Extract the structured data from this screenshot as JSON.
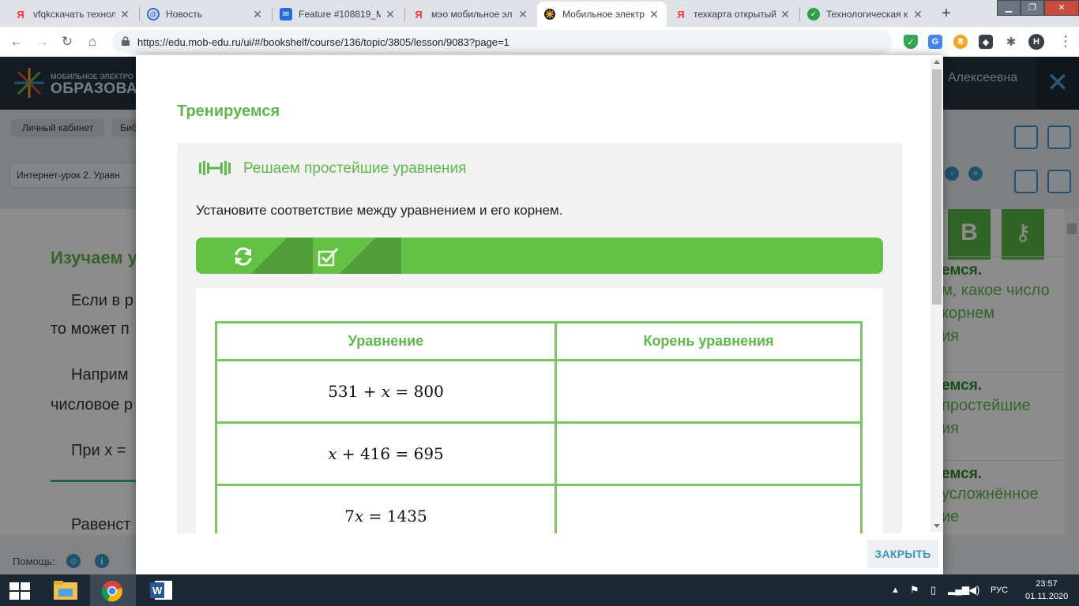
{
  "browser": {
    "tabs": [
      {
        "label": "vfqkскачать технол",
        "favicon": "yandex-icon",
        "favicon_color": "#f33"
      },
      {
        "label": "Новость",
        "favicon": "at-icon",
        "favicon_color": "#2a6ad8"
      },
      {
        "label": "Feature #108819_М",
        "favicon": "mail-icon",
        "favicon_color": "#2a6ad8"
      },
      {
        "label": "мэо мобильное эл",
        "favicon": "yandex-icon",
        "favicon_color": "#f33"
      },
      {
        "label": "Мобильное электр",
        "favicon": "meo-logo-icon",
        "favicon_color": "#333"
      },
      {
        "label": "техкарта открытый",
        "favicon": "yandex-icon",
        "favicon_color": "#f33"
      },
      {
        "label": "Технологическая к",
        "favicon": "check-circle-icon",
        "favicon_color": "#2ea043"
      }
    ],
    "active_tab_index": 4,
    "url": "https://edu.mob-edu.ru/ui/#/bookshelf/course/136/topic/3805/lesson/9083?page=1",
    "profile_initial": "H"
  },
  "site": {
    "logo_small": "МОБИЛЬНОЕ ЭЛЕКТРО",
    "logo_big": "ОБРАЗОВАН",
    "user_name": "Алексеевна",
    "breadcrumbs": [
      "Личный кабинет",
      "Биб"
    ],
    "lesson_title": "Интернет-урок 2. Уравн",
    "bg_heading": "Изучаем у",
    "bg_lines": [
      "Если в р",
      "то может п",
      "Наприм",
      "числовое р",
      "При x =",
      "Равенст"
    ],
    "right_panel_btn_b": "B",
    "right_items": [
      {
        "t1": "емся.",
        "t2": [
          "м, какое число",
          "корнем",
          "ия"
        ]
      },
      {
        "t1": "емся.",
        "t2": [
          "простейшие",
          "ия"
        ]
      },
      {
        "t1": "емся.",
        "t2": [
          "усложнённое",
          "ие"
        ]
      }
    ],
    "help_label": "Помощь:"
  },
  "modal": {
    "section_title": "Тренируемся",
    "card_title": "Решаем простейшие уравнения",
    "task_text": "Установите соответствие между уравнением и его корнем.",
    "close_label": "ЗАКРЫТЬ",
    "table": {
      "headers": [
        "Уравнение",
        "Корень уравнения"
      ],
      "rows": [
        {
          "equation": "531 + x = 800",
          "root": ""
        },
        {
          "equation": "x + 416 = 695",
          "root": ""
        },
        {
          "equation": "7x = 1435",
          "root": ""
        }
      ]
    },
    "colors": {
      "accent_green": "#5fb84c",
      "bar_green": "#63c145",
      "border_green": "#7dc468"
    }
  },
  "taskbar": {
    "lang": "РУС",
    "time": "23:57",
    "date": "01.11.2020"
  }
}
